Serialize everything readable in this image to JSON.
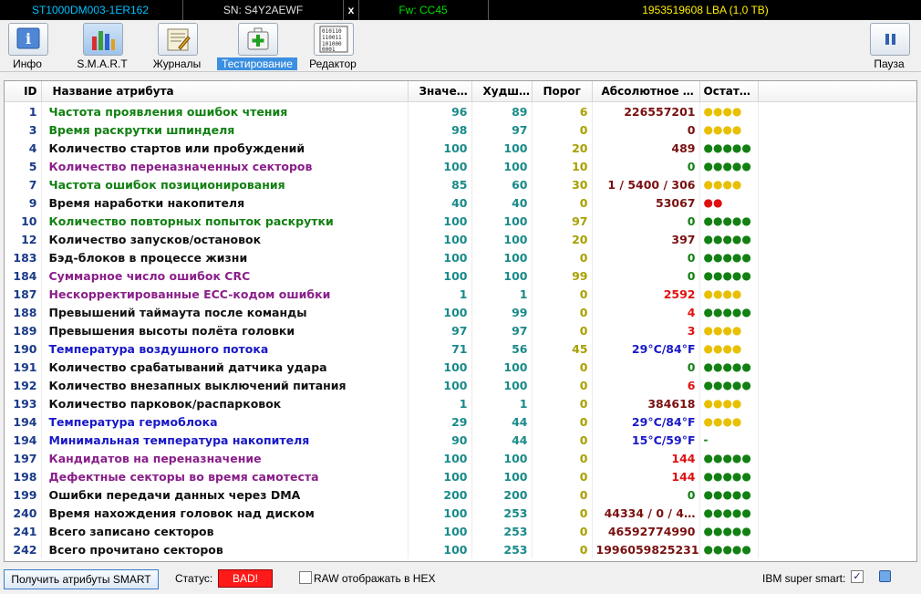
{
  "topbar": {
    "model": "ST1000DM003-1ER162",
    "serial": "SN: S4Y2AEWF",
    "close": "x",
    "firmware": "Fw: CC45",
    "capacity": "1953519608 LBA (1,0 TB)"
  },
  "toolbar": {
    "info": "Инфо",
    "smart": "S.M.A.R.T",
    "logs": "Журналы",
    "testing": "Тестирование",
    "editor": "Редактор",
    "editor_icon_text": "010110\n110011\n101000\n0001",
    "pause": "Пауза"
  },
  "table": {
    "headers": [
      "ID",
      "Название атрибута",
      "Значе…",
      "Худш…",
      "Порог",
      "Абсолютное …",
      "Остат…"
    ],
    "rows": [
      {
        "id": "1",
        "name": "Частота проявления ошибок чтения",
        "val": "96",
        "worst": "89",
        "thr": "6",
        "raw": "226557201",
        "health": "●●●●",
        "name_color": "green",
        "thr_color": "yellow",
        "raw_color": "maroon",
        "health_color": "#e8c000"
      },
      {
        "id": "3",
        "name": "Время раскрутки шпинделя",
        "val": "98",
        "worst": "97",
        "thr": "0",
        "raw": "0",
        "health": "●●●●",
        "name_color": "green",
        "thr_color": "yellow",
        "raw_color": "maroon",
        "health_color": "#e8c000"
      },
      {
        "id": "4",
        "name": "Количество стартов или пробуждений",
        "val": "100",
        "worst": "100",
        "thr": "20",
        "raw": "489",
        "health": "●●●●●",
        "name_color": "black",
        "thr_color": "yellow",
        "raw_color": "maroon",
        "health_color": "#128012"
      },
      {
        "id": "5",
        "name": "Количество переназначенных секторов",
        "val": "100",
        "worst": "100",
        "thr": "10",
        "raw": "0",
        "health": "●●●●●",
        "name_color": "purple",
        "thr_color": "yellow",
        "raw_color": "green",
        "health_color": "#128012"
      },
      {
        "id": "7",
        "name": "Частота ошибок позиционирования",
        "val": "85",
        "worst": "60",
        "thr": "30",
        "raw": "1 / 5400 / 306",
        "health": "●●●●",
        "name_color": "green",
        "thr_color": "yellow",
        "raw_color": "maroon",
        "health_color": "#e8c000"
      },
      {
        "id": "9",
        "name": "Время наработки накопителя",
        "val": "40",
        "worst": "40",
        "thr": "0",
        "raw": "53067",
        "health": "●●",
        "name_color": "black",
        "thr_color": "yellow",
        "raw_color": "maroon",
        "health_color": "#e01010"
      },
      {
        "id": "10",
        "name": "Количество повторных попыток раскрутки",
        "val": "100",
        "worst": "100",
        "thr": "97",
        "raw": "0",
        "health": "●●●●●",
        "name_color": "green",
        "thr_color": "yellow",
        "raw_color": "green",
        "health_color": "#128012"
      },
      {
        "id": "12",
        "name": "Количество запусков/остановок",
        "val": "100",
        "worst": "100",
        "thr": "20",
        "raw": "397",
        "health": "●●●●●",
        "name_color": "black",
        "thr_color": "yellow",
        "raw_color": "maroon",
        "health_color": "#128012"
      },
      {
        "id": "183",
        "name": "Бэд-блоков в процессе жизни",
        "val": "100",
        "worst": "100",
        "thr": "0",
        "raw": "0",
        "health": "●●●●●",
        "name_color": "black",
        "thr_color": "yellow",
        "raw_color": "green",
        "health_color": "#128012"
      },
      {
        "id": "184",
        "name": "Суммарное число ошибок CRC",
        "val": "100",
        "worst": "100",
        "thr": "99",
        "raw": "0",
        "health": "●●●●●",
        "name_color": "purple",
        "thr_color": "yellow",
        "raw_color": "green",
        "health_color": "#128012"
      },
      {
        "id": "187",
        "name": "Нескорректированные ECC-кодом ошибки",
        "val": "1",
        "worst": "1",
        "thr": "0",
        "raw": "2592",
        "health": "●●●●",
        "name_color": "purple",
        "thr_color": "yellow",
        "raw_color": "red",
        "health_color": "#e8c000"
      },
      {
        "id": "188",
        "name": "Превышений таймаута после команды",
        "val": "100",
        "worst": "99",
        "thr": "0",
        "raw": "4",
        "health": "●●●●●",
        "name_color": "black",
        "thr_color": "yellow",
        "raw_color": "red",
        "health_color": "#128012"
      },
      {
        "id": "189",
        "name": "Превышения высоты полёта головки",
        "val": "97",
        "worst": "97",
        "thr": "0",
        "raw": "3",
        "health": "●●●●",
        "name_color": "black",
        "thr_color": "yellow",
        "raw_color": "red",
        "health_color": "#e8c000"
      },
      {
        "id": "190",
        "name": "Температура воздушного потока",
        "val": "71",
        "worst": "56",
        "thr": "45",
        "raw": "29°C/84°F",
        "health": "●●●●",
        "name_color": "blue",
        "thr_color": "yellow",
        "raw_color": "blue",
        "health_color": "#e8c000"
      },
      {
        "id": "191",
        "name": "Количество срабатываний датчика удара",
        "val": "100",
        "worst": "100",
        "thr": "0",
        "raw": "0",
        "health": "●●●●●",
        "name_color": "black",
        "thr_color": "yellow",
        "raw_color": "green",
        "health_color": "#128012"
      },
      {
        "id": "192",
        "name": "Количество внезапных выключений питания",
        "val": "100",
        "worst": "100",
        "thr": "0",
        "raw": "6",
        "health": "●●●●●",
        "name_color": "black",
        "thr_color": "yellow",
        "raw_color": "red",
        "health_color": "#128012"
      },
      {
        "id": "193",
        "name": "Количество парковок/распарковок",
        "val": "1",
        "worst": "1",
        "thr": "0",
        "raw": "384618",
        "health": "●●●●",
        "name_color": "black",
        "thr_color": "yellow",
        "raw_color": "maroon",
        "health_color": "#e8c000"
      },
      {
        "id": "194",
        "name": "Температура гермоблока",
        "val": "29",
        "worst": "44",
        "thr": "0",
        "raw": "29°C/84°F",
        "health": "●●●●",
        "name_color": "blue",
        "thr_color": "yellow",
        "raw_color": "blue",
        "health_color": "#e8c000"
      },
      {
        "id": "194",
        "name": "Минимальная температура накопителя",
        "val": "90",
        "worst": "44",
        "thr": "0",
        "raw": "15°C/59°F",
        "health": "-",
        "name_color": "blue",
        "thr_color": "yellow",
        "raw_color": "blue",
        "health_color": "#128012"
      },
      {
        "id": "197",
        "name": "Кандидатов на переназначение",
        "val": "100",
        "worst": "100",
        "thr": "0",
        "raw": "144",
        "health": "●●●●●",
        "name_color": "purple",
        "thr_color": "yellow",
        "raw_color": "red",
        "health_color": "#128012"
      },
      {
        "id": "198",
        "name": "Дефектные секторы во время самотеста",
        "val": "100",
        "worst": "100",
        "thr": "0",
        "raw": "144",
        "health": "●●●●●",
        "name_color": "purple",
        "thr_color": "yellow",
        "raw_color": "red",
        "health_color": "#128012"
      },
      {
        "id": "199",
        "name": "Ошибки передачи данных через DMA",
        "val": "200",
        "worst": "200",
        "thr": "0",
        "raw": "0",
        "health": "●●●●●",
        "name_color": "black",
        "thr_color": "yellow",
        "raw_color": "green",
        "health_color": "#128012"
      },
      {
        "id": "240",
        "name": "Время нахождения головок над диском",
        "val": "100",
        "worst": "253",
        "thr": "0",
        "raw": "44334 / 0 / 4…",
        "health": "●●●●●",
        "name_color": "black",
        "thr_color": "yellow",
        "raw_color": "maroon",
        "health_color": "#128012"
      },
      {
        "id": "241",
        "name": "Всего записано секторов",
        "val": "100",
        "worst": "253",
        "thr": "0",
        "raw": "46592774990",
        "health": "●●●●●",
        "name_color": "black",
        "thr_color": "yellow",
        "raw_color": "maroon",
        "health_color": "#128012"
      },
      {
        "id": "242",
        "name": "Всего прочитано секторов",
        "val": "100",
        "worst": "253",
        "thr": "0",
        "raw": "1996059825231",
        "health": "●●●●●",
        "name_color": "black",
        "thr_color": "yellow",
        "raw_color": "maroon",
        "health_color": "#128012"
      }
    ]
  },
  "statusbar": {
    "get_smart": "Получить атрибуты SMART",
    "status_label": "Статус:",
    "status_value": "BAD!",
    "raw_hex": "RAW отображать в HEX",
    "ibm_super_smart": "IBM super smart:",
    "ibm_checked_mark": "✓"
  },
  "colors": {
    "status_bad": "#ff1a1a",
    "accent_tab": "#3b8fe0",
    "name_green": "#128012",
    "name_purple": "#8a1f8a",
    "name_blue": "#1818c8"
  }
}
